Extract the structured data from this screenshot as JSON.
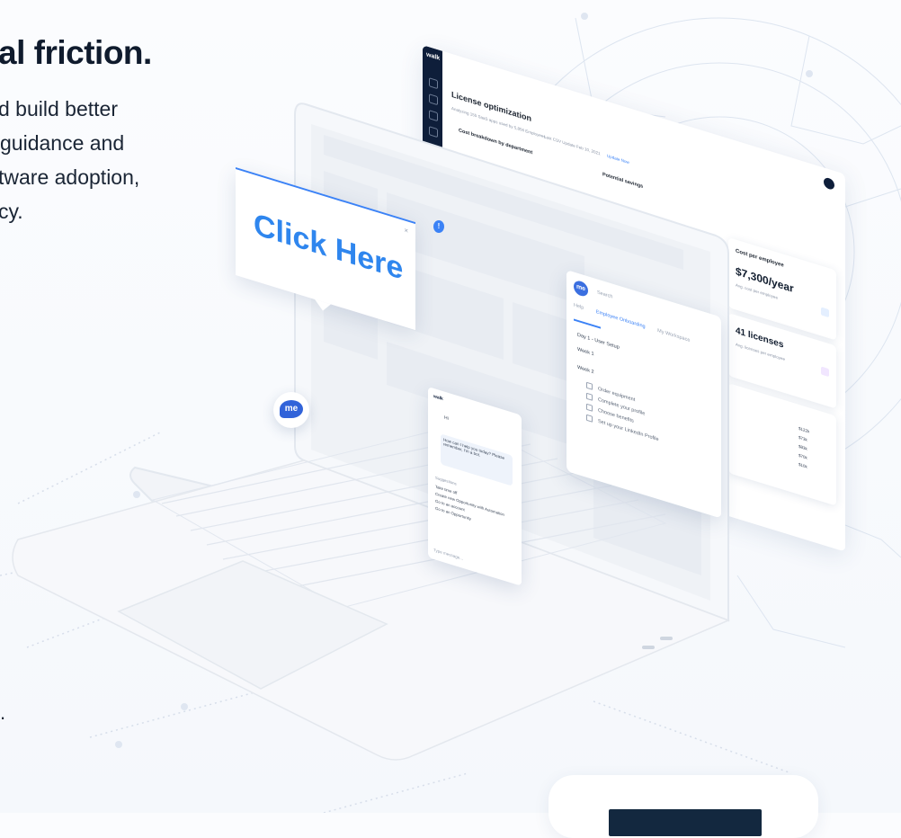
{
  "hero": {
    "title": "al friction.",
    "lines": [
      "d build better",
      "guidance and",
      "tware adoption,",
      "cy."
    ],
    "trailing_fragment": "."
  },
  "dashboard": {
    "logo": "walk",
    "title": "License optimization",
    "subtitle": "Analyzing 155 SaaS apps used by 5,856 Employees",
    "last_update": "Last CSV Update Feb 10, 2021",
    "update_link": "Update Now",
    "cost_breakdown": "Cost breakdown by department",
    "potential_savings": "Potential savings",
    "cost_per_employee_label": "Cost per employee",
    "cost_per_employee_value": "$7,300/year",
    "cost_per_employee_sub": "Avg. cost per employee",
    "licenses_value": "41 licenses",
    "licenses_sub": "Avg. licenses per employee",
    "table_values": [
      "$122k",
      "$73k",
      "$83k",
      "$70k",
      "$10k"
    ]
  },
  "callout": {
    "text": "Click Here",
    "close": "×"
  },
  "onboarding": {
    "logo": "me",
    "search_placeholder": "Search",
    "tabs": [
      "Help",
      "Employee Onboarding",
      "My Workspace"
    ],
    "items": [
      "Day 1 - User Setup",
      "Week 1",
      "Week 2"
    ],
    "subitems": [
      "Order equipment",
      "Complete your profile",
      "Choose benefits",
      "Set up your LinkedIn Profile"
    ]
  },
  "chat": {
    "logo": "walk",
    "greeting": "Hi",
    "bubble": "How can I help you today? Please remember, I'm a bot.",
    "suggestions_label": "Suggestions",
    "suggestions": [
      "Take time off",
      "Create new Opportunity with Automation",
      "Go to an account",
      "Go to an Opportunity"
    ],
    "input_placeholder": "Type message..."
  },
  "me_badge": "me",
  "notification": "!",
  "colors": {
    "accent": "#3b82f6",
    "navy": "#0e1e3a"
  }
}
